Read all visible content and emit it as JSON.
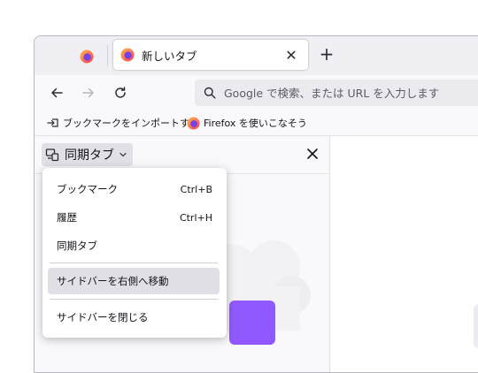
{
  "tabs": {
    "pinned_icon": "firefox-logo",
    "active_title": "新しいタブ",
    "close_glyph": "✕",
    "new_tab_glyph": "+"
  },
  "navbar": {
    "url_placeholder": "Google で検索、または URL を入力します"
  },
  "bookmarks": {
    "items": [
      {
        "label": "ブックマークをインポートす...",
        "icon": "import-icon"
      },
      {
        "label": "Firefox を使いこなそう",
        "icon": "firefox-logo"
      }
    ]
  },
  "sidebar": {
    "title": "同期タブ",
    "close_glyph": "✕"
  },
  "menu": {
    "items": [
      {
        "label": "ブックマーク",
        "shortcut": "Ctrl+B"
      },
      {
        "label": "履歴",
        "shortcut": "Ctrl+H"
      },
      {
        "label": "同期タブ",
        "shortcut": ""
      },
      {
        "label": "サイドバーを右側へ移動",
        "shortcut": ""
      },
      {
        "label": "サイドバーを閉じる",
        "shortcut": ""
      }
    ]
  },
  "colors": {
    "accent": "#7542e5",
    "chrome": "#f0f0f4",
    "firefox_orange": "#ff7139"
  }
}
